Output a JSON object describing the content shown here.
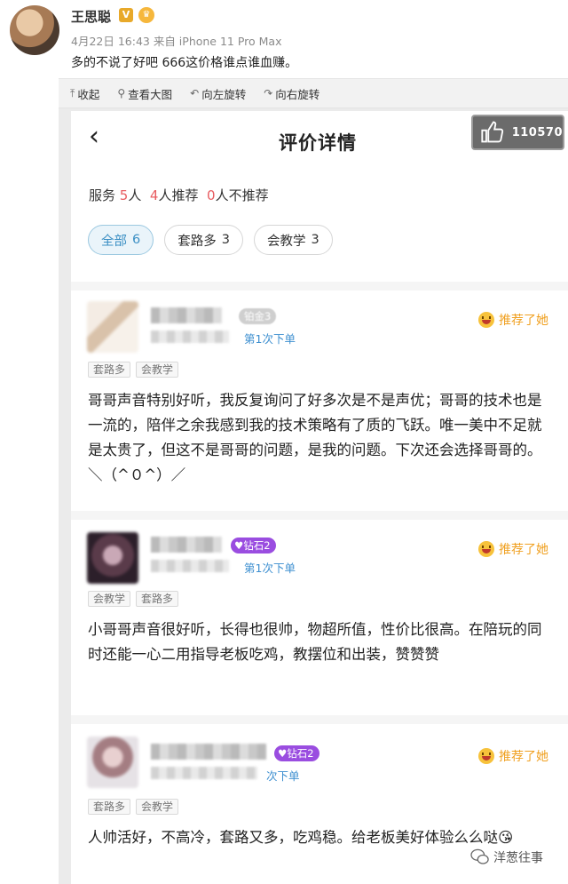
{
  "post": {
    "username": "王思聪",
    "verified_badge": "V",
    "meta": "4月22日 16:43 来自 iPhone 11 Pro Max",
    "text": "多的不说了好吧 666这价格谁点谁血赚。"
  },
  "toolbar": {
    "collapse": "收起",
    "view_large": "查看大图",
    "rotate_left": "向左旋转",
    "rotate_right": "向右旋转"
  },
  "screen": {
    "title": "评价详情",
    "like_count": "110570",
    "summary": {
      "prefix": "服务",
      "service_count": "5",
      "people_unit": "人",
      "recommend_count": "4",
      "recommend_label": "人推荐",
      "not_recommend_count": "0",
      "not_recommend_label": "人不推荐"
    },
    "filters": [
      {
        "label": "全部",
        "count": "6"
      },
      {
        "label": "套路多",
        "count": "3"
      },
      {
        "label": "会教学",
        "count": "3"
      }
    ]
  },
  "reviews": [
    {
      "level": "铂金3",
      "order": "第1次下单",
      "recommend": "推荐了她",
      "tags": [
        "套路多",
        "会教学"
      ],
      "text": "哥哥声音特别好听，我反复询问了好多次是不是声优；哥哥的技术也是一流的，陪伴之余我感到我的技术策略有了质的飞跃。唯一美中不足就是太贵了，但这不是哥哥的问题，是我的问题。下次还会选择哥哥的。＼（^０^）／"
    },
    {
      "level": "钻石2",
      "order": "第1次下单",
      "recommend": "推荐了她",
      "tags": [
        "会教学",
        "套路多"
      ],
      "text": "小哥哥声音很好听，长得也很帅，物超所值，性价比很高。在陪玩的同时还能一心二用指导老板吃鸡，教摆位和出装，赞赞赞"
    },
    {
      "level": "钻石2",
      "order": "次下单",
      "recommend": "推荐了她",
      "tags": [
        "套路多",
        "会教学"
      ],
      "text": "人帅活好，不高冷，套路又多，吃鸡稳。给老板美好体验么么哒",
      "emoji": "😘"
    }
  ],
  "watermark": "洋葱往事",
  "colors": {
    "accent_red": "#e85c60",
    "chip_active": "#3b8fc4",
    "recommend_orange": "#f0a020",
    "order_blue": "#3d8fd0",
    "diamond_purple": "#9a4de0"
  }
}
